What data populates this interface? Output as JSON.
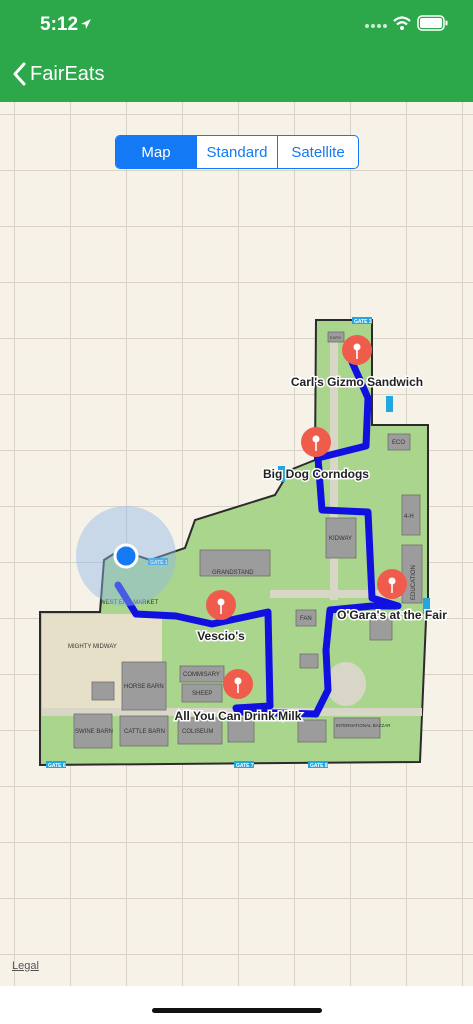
{
  "status": {
    "time": "5:12"
  },
  "nav": {
    "back_label": "FairEats"
  },
  "segments": [
    "Map",
    "Standard",
    "Satellite"
  ],
  "legal": "Legal",
  "pins": [
    {
      "label": "Carl's Gizmo Sandwich"
    },
    {
      "label": "Big Dog Corndogs"
    },
    {
      "label": "O'Gara's at the Fair"
    },
    {
      "label": "Vescio's"
    },
    {
      "label": "All You Can Drink Milk"
    }
  ],
  "fair_labels": {
    "grandstand": "GRANDSTAND",
    "west_end_market": "WEST END MARKET",
    "mighty_midway": "MIGHTY MIDWAY",
    "horse_barn": "HORSE BARN",
    "commisary": "COMMISARY",
    "sheep": "SHEEP",
    "swine_barn": "SWINE BARN",
    "cattle_barn": "CATTLE BARN",
    "coliseum": "COLISEUM",
    "fan": "FAN",
    "kidway": "KIDWAY",
    "education": "EDUCATION",
    "eco": "ECO",
    "four_h": "4-H",
    "international_bazzar": "INTERNATIONAL BAZZAR",
    "expo": "EXPO"
  },
  "gates": {
    "gate1": "GATE 1",
    "gate3": "GATE 3",
    "gate6": "GATE 6",
    "gate7": "GATE 7",
    "gate8": "GATE 8"
  },
  "colors": {
    "brand": "#2ca84a",
    "accent": "#1479f5",
    "route": "#1010e0",
    "pin": "#f05c4c"
  }
}
